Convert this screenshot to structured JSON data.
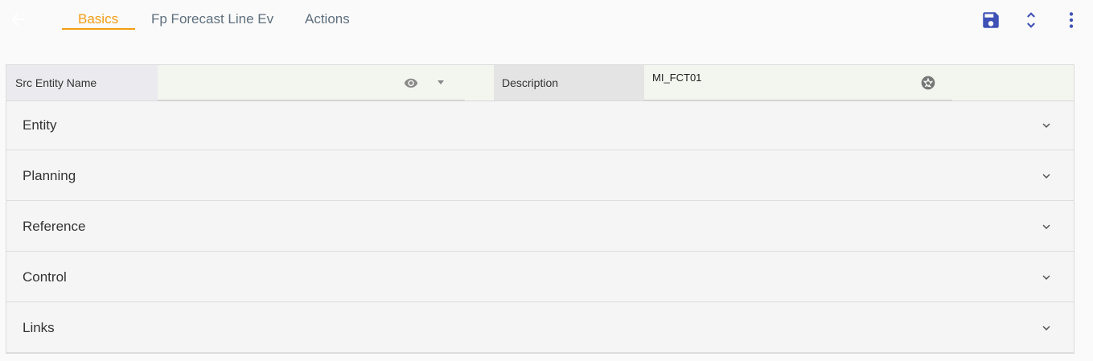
{
  "tabs": [
    {
      "label": "Basics",
      "active": true
    },
    {
      "label": "Fp Forecast Line Ev",
      "active": false
    },
    {
      "label": "Actions",
      "active": false
    }
  ],
  "toolbar": {
    "icons": [
      "arrow-back-icon",
      "save-icon",
      "unfold-icon",
      "more-vert-icon"
    ]
  },
  "fields": {
    "src_entity_name": {
      "label": "Src Entity Name",
      "value": ""
    },
    "description": {
      "label": "Description",
      "value": "MI_FCT01"
    }
  },
  "sections": [
    {
      "title": "Entity"
    },
    {
      "title": "Planning"
    },
    {
      "title": "Reference"
    },
    {
      "title": "Control"
    },
    {
      "title": "Links"
    }
  ],
  "colors": {
    "accent": "#f39c12",
    "icon_blue": "#3f51b5",
    "tab_text": "#5f6f7e"
  }
}
